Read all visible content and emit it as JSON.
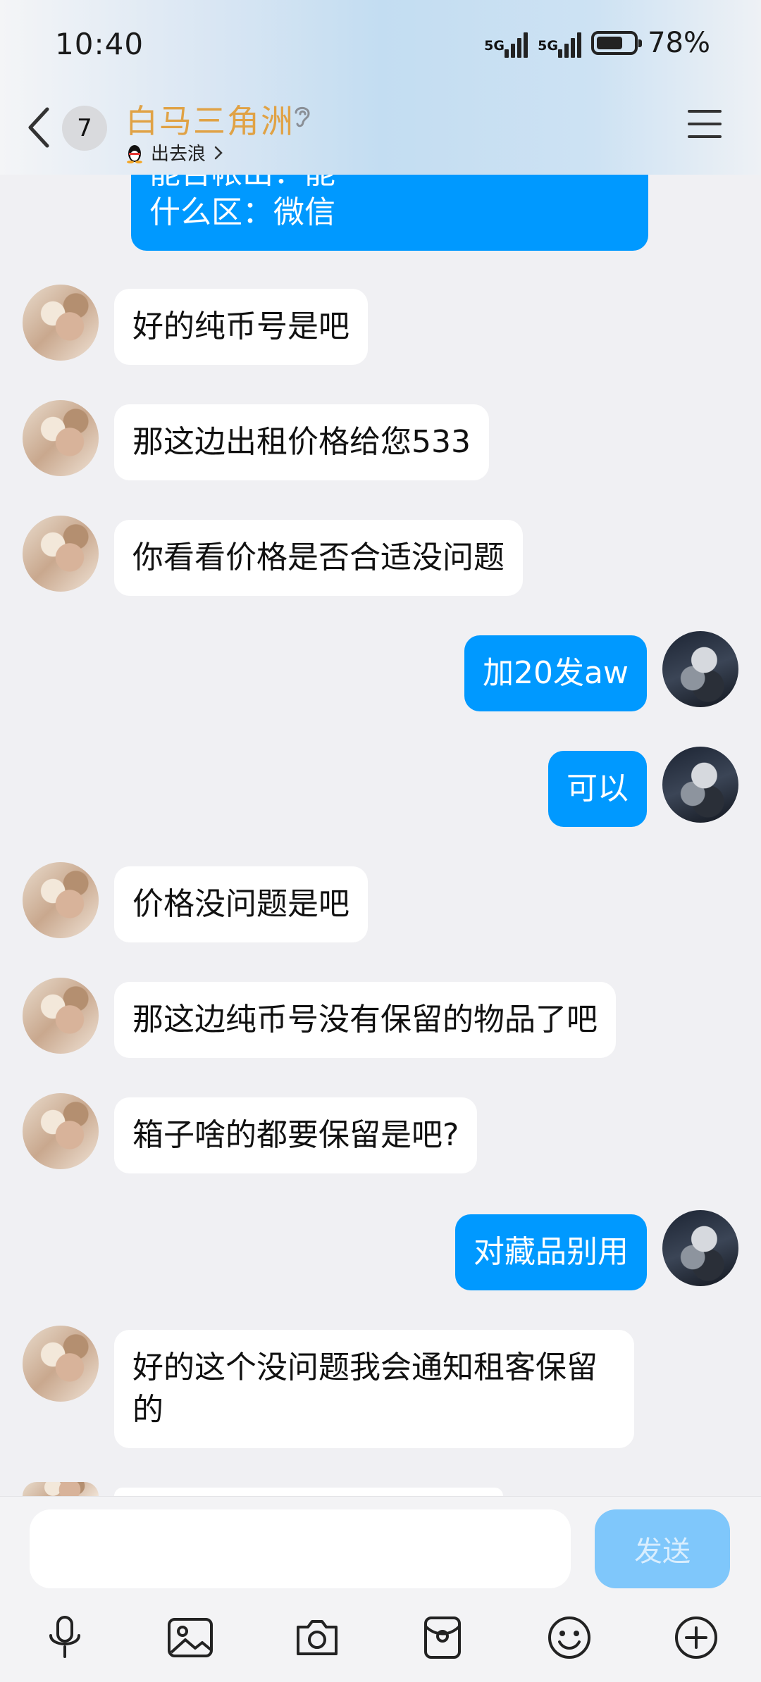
{
  "status": {
    "time": "10:40",
    "network1": "5G",
    "network2": "5G",
    "battery": "78%",
    "battery_level": 0.78
  },
  "header": {
    "unread_count": "7",
    "title": "白马三角洲",
    "subtitle": "出去浪"
  },
  "messages": [
    {
      "side": "out",
      "text": "什么区：微信",
      "partial_top": "能否帐出：能"
    },
    {
      "side": "in",
      "text": "好的纯币号是吧"
    },
    {
      "side": "in",
      "text": "那这边出租价格给您533"
    },
    {
      "side": "in",
      "text": "你看看价格是否合适没问题"
    },
    {
      "side": "out",
      "text": "加20发aw"
    },
    {
      "side": "out",
      "text": "可以"
    },
    {
      "side": "in",
      "text": "价格没问题是吧"
    },
    {
      "side": "in",
      "text": "那这边纯币号没有保留的物品了吧"
    },
    {
      "side": "in",
      "text": "箱子啥的都要保留是吧?"
    },
    {
      "side": "out",
      "text": "对藏品别用"
    },
    {
      "side": "in",
      "text": "好的这个没问题我会通知租客保留的"
    }
  ],
  "input": {
    "placeholder": "",
    "send_label": "发送"
  },
  "toolbar": [
    "microphone-icon",
    "image-icon",
    "camera-icon",
    "red-packet-icon",
    "emoji-icon",
    "plus-icon"
  ],
  "colors": {
    "out_bubble": "#0099ff",
    "in_bubble": "#ffffff",
    "title": "#e0a245",
    "send_disabled": "#7fc7fb"
  }
}
